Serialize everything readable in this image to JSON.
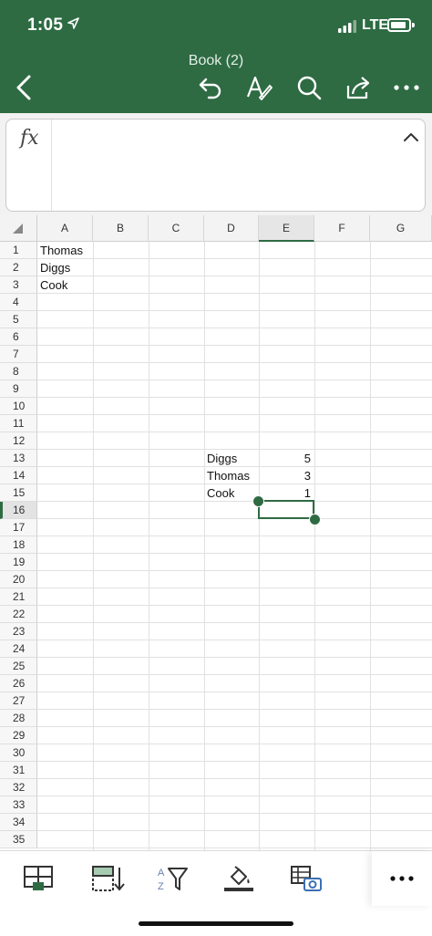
{
  "status_bar": {
    "time": "1:05",
    "network": "LTE"
  },
  "title_bar": {
    "book_title": "Book (2)"
  },
  "formula_bar": {
    "fx_label": "fx",
    "value": ""
  },
  "grid": {
    "column_headers": [
      "A",
      "B",
      "C",
      "D",
      "E",
      "F",
      "G"
    ],
    "selected_column": "E",
    "row_numbers": [
      "1",
      "2",
      "3",
      "4",
      "5",
      "6",
      "7",
      "8",
      "9",
      "10",
      "11",
      "12",
      "13",
      "14",
      "15",
      "16",
      "17",
      "18",
      "19",
      "20",
      "21",
      "22",
      "23",
      "24",
      "25",
      "26",
      "27",
      "28",
      "29",
      "30",
      "31",
      "32",
      "33",
      "34",
      "35"
    ],
    "selected_row": "16",
    "cells": {
      "A1": "Thomas",
      "A2": "Diggs",
      "A3": "Cook",
      "D13": "Diggs",
      "E13": "5",
      "D14": "Thomas",
      "E14": "3",
      "D15": "Cook",
      "E15": "1"
    },
    "selected_cell": "E16"
  },
  "bottom_toolbar": {
    "icons": [
      "table-insert-icon",
      "freeze-panes-icon",
      "sort-filter-icon",
      "fill-color-icon",
      "table-camera-icon",
      "more-icon"
    ]
  },
  "colors": {
    "accent": "#2e6b43"
  }
}
